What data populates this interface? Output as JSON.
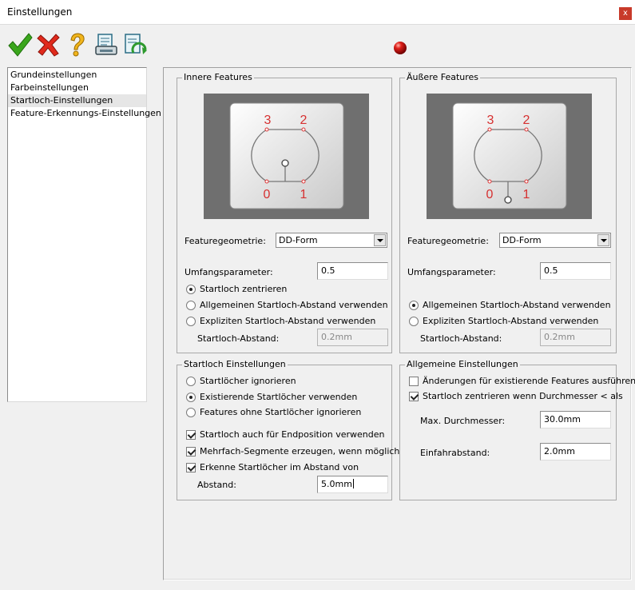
{
  "window": {
    "title": "Einstellungen",
    "close": "x"
  },
  "toolbar": {
    "icons": [
      "check-icon",
      "cancel-icon",
      "help-icon",
      "print-preview-icon",
      "refresh-document-icon"
    ],
    "status_color": "#cc1111"
  },
  "nav": {
    "items": [
      {
        "label": "Grundeinstellungen"
      },
      {
        "label": "Farbeinstellungen"
      },
      {
        "label": "Startloch-Einstellungen",
        "selected": true
      },
      {
        "label": "Feature-Erkennungs-Einstellungen"
      }
    ]
  },
  "inner": {
    "title": "Innere Features",
    "preview": {
      "labels": [
        "3",
        "2",
        "0",
        "1"
      ]
    },
    "geometry_label": "Featuregeometrie:",
    "geometry_value": "DD-Form",
    "perimeter_label": "Umfangsparameter:",
    "perimeter_value": "0.5",
    "radio_center": "Startloch zentrieren",
    "radio_general": "Allgemeinen Startloch-Abstand verwenden",
    "radio_explicit": "Expliziten Startloch-Abstand verwenden",
    "distance_label": "Startloch-Abstand:",
    "distance_value": "0.2mm"
  },
  "outer": {
    "title": "Äußere Features",
    "preview": {
      "labels": [
        "3",
        "2",
        "0",
        "1"
      ]
    },
    "geometry_label": "Featuregeometrie:",
    "geometry_value": "DD-Form",
    "perimeter_label": "Umfangsparameter:",
    "perimeter_value": "0.5",
    "radio_general": "Allgemeinen Startloch-Abstand verwenden",
    "radio_explicit": "Expliziten Startloch-Abstand verwenden",
    "distance_label": "Startloch-Abstand:",
    "distance_value": "0.2mm"
  },
  "startloch": {
    "title": "Startloch Einstellungen",
    "radio_ignore": "Startlöcher ignorieren",
    "radio_use": "Existierende Startlöcher verwenden",
    "radio_skip": "Features ohne Startlöcher ignorieren",
    "check_endpos": "Startloch auch für Endposition verwenden",
    "check_multi": "Mehrfach-Segmente erzeugen, wenn möglich",
    "check_detect": "Erkenne Startlöcher im Abstand von",
    "distance_label": "Abstand:",
    "distance_value": "5.0mm"
  },
  "general": {
    "title": "Allgemeine Einstellungen",
    "check_apply": "Änderungen für existierende Features ausführen",
    "check_center": "Startloch zentrieren wenn Durchmesser < als",
    "max_label": "Max. Durchmesser:",
    "max_value": "30.0mm",
    "approach_label": "Einfahrabstand:",
    "approach_value": "2.0mm"
  }
}
